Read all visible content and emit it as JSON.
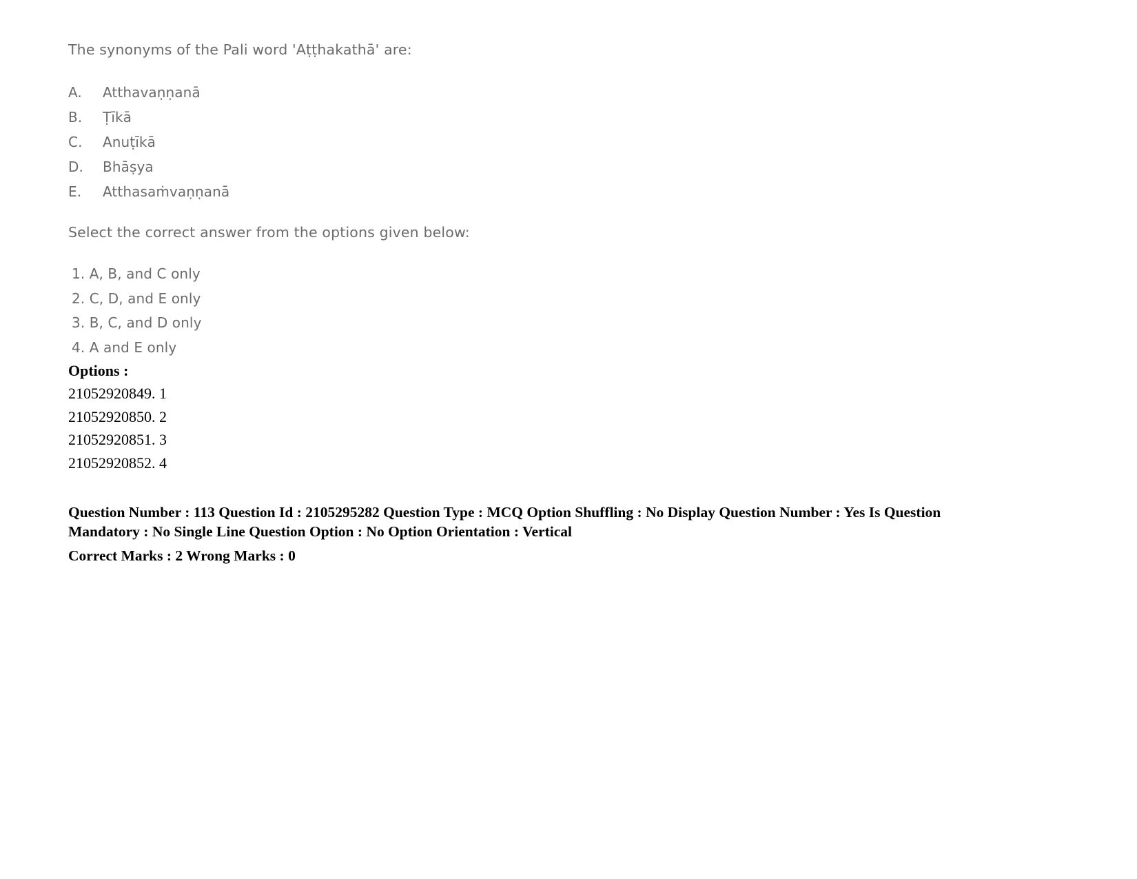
{
  "question": {
    "stem": "The synonyms of the Pali word 'Aṭṭhakathā' are:",
    "statements": [
      {
        "letter": "A.",
        "text": "Atthavaṇṇanā"
      },
      {
        "letter": "B.",
        "text": "Ṭīkā"
      },
      {
        "letter": "C.",
        "text": "Anuṭīkā"
      },
      {
        "letter": "D.",
        "text": "Bhāṣya"
      },
      {
        "letter": "E.",
        "text": "Atthasaṁvaṇṇanā"
      }
    ],
    "instruction": "Select the correct answer from the options given below:",
    "choices": [
      "1. A, B, and C only",
      "2. C, D, and E only",
      "3. B, C, and D only",
      "4. A and E only"
    ]
  },
  "options_section": {
    "heading": "Options :",
    "items": [
      "21052920849. 1",
      "21052920850. 2",
      "21052920851. 3",
      "21052920852. 4"
    ]
  },
  "metadata": {
    "line1": "Question Number : 113 Question Id : 2105295282 Question Type : MCQ Option Shuffling : No Display Question Number : Yes Is Question Mandatory : No Single Line Question Option : No Option Orientation : Vertical",
    "line2": "Correct Marks : 2 Wrong Marks : 0",
    "question_number": "113",
    "question_id": "2105295282",
    "question_type": "MCQ",
    "option_shuffling": "No",
    "display_question_number": "Yes",
    "is_question_mandatory": "No",
    "single_line_question_option": "No",
    "option_orientation": "Vertical",
    "correct_marks": "2",
    "wrong_marks": "0"
  },
  "colors": {
    "page_background": "#ffffff",
    "scanned_text": "#6b6b6b",
    "digital_text": "#000000"
  }
}
